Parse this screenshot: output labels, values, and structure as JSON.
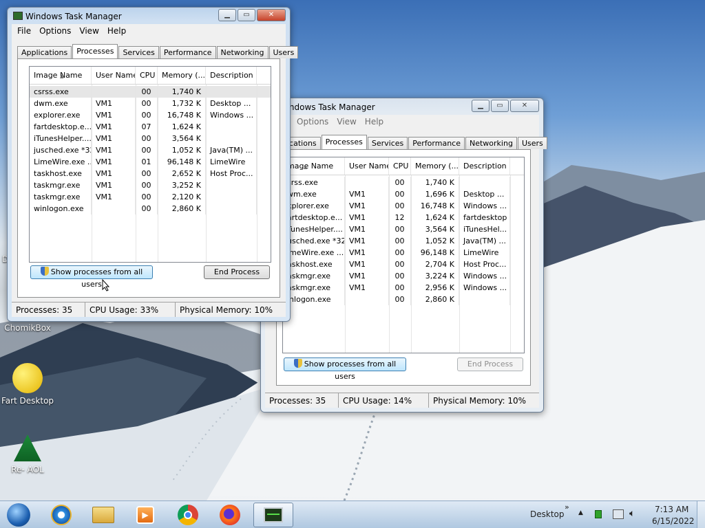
{
  "colors": {
    "accent": "#3c7fb1",
    "close": "#c6422a",
    "selected_row": "#e6e6e6"
  },
  "desktop": {
    "icons": [
      {
        "label": "ChomikBox",
        "icon": "chomikbox-icon"
      },
      {
        "label": "Fart Desktop",
        "icon": "smiley-icon"
      },
      {
        "label": "Re- AOL",
        "icon": "aol-tree-icon"
      }
    ],
    "left_edge_letter": "D"
  },
  "win1": {
    "title": "Windows Task Manager",
    "menu": [
      "File",
      "Options",
      "View",
      "Help"
    ],
    "tabs": [
      "Applications",
      "Processes",
      "Services",
      "Performance",
      "Networking",
      "Users"
    ],
    "active_tab": "Processes",
    "columns": [
      "Image Name",
      "User Name",
      "CPU",
      "Memory (...",
      "Description"
    ],
    "rows": [
      [
        "csrss.exe",
        "",
        "00",
        "1,740 K",
        ""
      ],
      [
        "dwm.exe",
        "VM1",
        "00",
        "1,732 K",
        "Desktop ..."
      ],
      [
        "explorer.exe",
        "VM1",
        "00",
        "16,748 K",
        "Windows ..."
      ],
      [
        "fartdesktop.e...",
        "VM1",
        "07",
        "1,624 K",
        ""
      ],
      [
        "iTunesHelper....",
        "VM1",
        "00",
        "3,564 K",
        ""
      ],
      [
        "jusched.exe *32",
        "VM1",
        "00",
        "1,052 K",
        "Java(TM) ..."
      ],
      [
        "LimeWire.exe ...",
        "VM1",
        "01",
        "96,148 K",
        "LimeWire"
      ],
      [
        "taskhost.exe",
        "VM1",
        "00",
        "2,652 K",
        "Host Proc..."
      ],
      [
        "taskmgr.exe",
        "VM1",
        "00",
        "3,252 K",
        ""
      ],
      [
        "taskmgr.exe",
        "VM1",
        "00",
        "2,120 K",
        ""
      ],
      [
        "winlogon.exe",
        "",
        "00",
        "2,860 K",
        ""
      ]
    ],
    "show_all_label": "Show processes from all users",
    "end_process_label": "End Process",
    "status": {
      "processes": "Processes: 35",
      "cpu": "CPU Usage: 33%",
      "memory": "Physical Memory: 10%"
    }
  },
  "win2": {
    "title": "Windows Task Manager",
    "menu": [
      "Options",
      "View",
      "Help"
    ],
    "tabs": [
      "ications",
      "Processes",
      "Services",
      "Performance",
      "Networking",
      "Users"
    ],
    "active_tab": "Processes",
    "columns": [
      "mage Name",
      "User Name",
      "CPU",
      "Memory (...",
      "Description"
    ],
    "rows": [
      [
        "srss.exe",
        "",
        "00",
        "1,740 K",
        ""
      ],
      [
        "wm.exe",
        "VM1",
        "00",
        "1,696 K",
        "Desktop ..."
      ],
      [
        "xplorer.exe",
        "VM1",
        "00",
        "16,748 K",
        "Windows ..."
      ],
      [
        "artdesktop.e...",
        "VM1",
        "12",
        "1,624 K",
        "fartdesktop"
      ],
      [
        "TunesHelper....",
        "VM1",
        "00",
        "3,564 K",
        "iTunesHel..."
      ],
      [
        "usched.exe *32",
        "VM1",
        "00",
        "1,052 K",
        "Java(TM) ..."
      ],
      [
        "imeWire.exe ...",
        "VM1",
        "00",
        "96,148 K",
        "LimeWire"
      ],
      [
        "askhost.exe",
        "VM1",
        "00",
        "2,704 K",
        "Host Proc..."
      ],
      [
        "askmgr.exe",
        "VM1",
        "00",
        "3,224 K",
        "Windows ..."
      ],
      [
        "askmgr.exe",
        "VM1",
        "00",
        "2,956 K",
        "Windows ..."
      ],
      [
        "inlogon.exe",
        "",
        "00",
        "2,860 K",
        ""
      ]
    ],
    "show_all_label": "Show processes from all users",
    "end_process_label": "End Process",
    "status": {
      "processes": "Processes: 35",
      "cpu": "CPU Usage: 14%",
      "memory": "Physical Memory: 10%"
    }
  },
  "taskbar": {
    "apps": [
      "start-orb-icon",
      "internet-explorer-icon",
      "file-explorer-icon",
      "media-player-icon",
      "chrome-icon",
      "firefox-icon",
      "task-manager-icon"
    ],
    "desktop_label": "Desktop",
    "chevron": "»",
    "time": "7:13 AM",
    "date": "6/15/2022"
  }
}
